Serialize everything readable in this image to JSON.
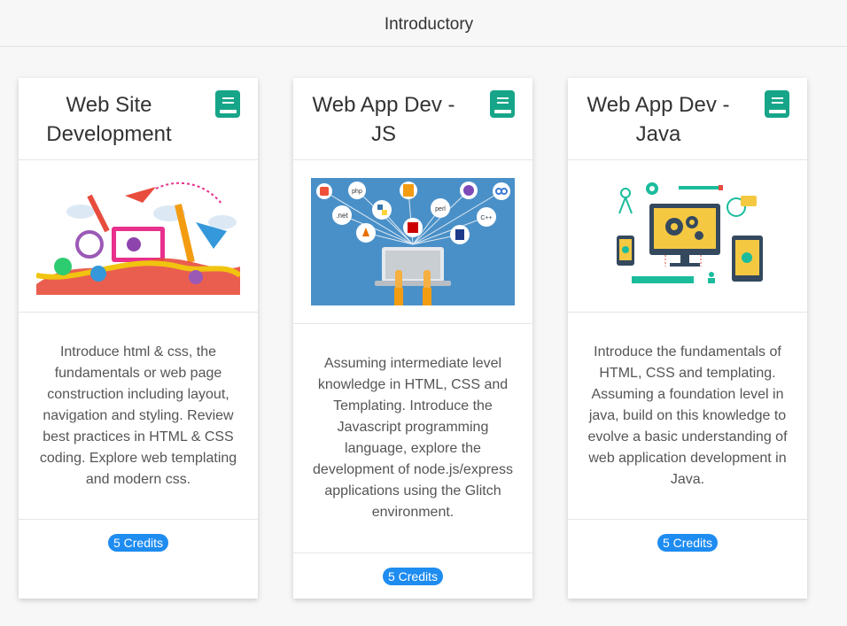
{
  "header": {
    "title": "Introductory"
  },
  "colors": {
    "accent": "#1e8cf0",
    "book_icon": "#17a589"
  },
  "cards": [
    {
      "title": "Web Site Development",
      "image_icon": "web-design-illustration",
      "description": "Introduce html & css, the fundamentals or web page construction including layout, navigation and styling. Review best practices in HTML & CSS coding. Explore web templating and modern css.",
      "credits": "5 Credits"
    },
    {
      "title": "Web App Dev - JS",
      "image_icon": "programming-languages-illustration",
      "description": "Assuming intermediate level knowledge in HTML, CSS and Templating. Introduce the Javascript programming language, explore the development of node.js/express applications using the Glitch environment.",
      "credits": "5 Credits",
      "image_labels": [
        ".net",
        "C++",
        "perl",
        "php"
      ]
    },
    {
      "title": "Web App Dev - Java",
      "image_icon": "web-app-devices-illustration",
      "description": "Introduce the fundamentals of HTML, CSS and templating. Assuming a foundation level in java, build on this knowledge to evolve a basic understanding of web application development in Java.",
      "credits": "5 Credits"
    }
  ]
}
